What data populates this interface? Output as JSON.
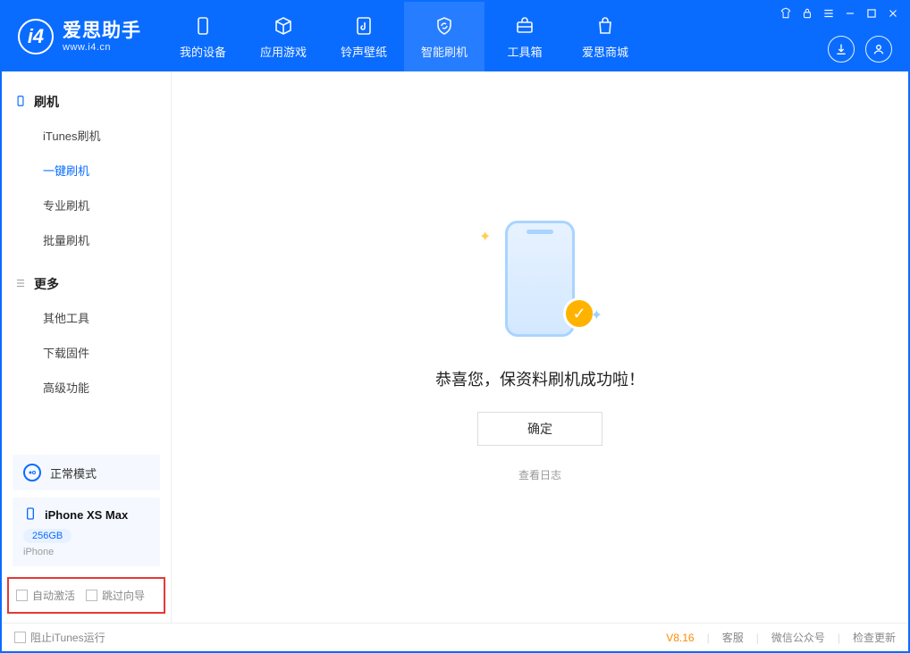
{
  "brand": {
    "title": "爱思助手",
    "sub": "www.i4.cn",
    "logo_letter": "i4"
  },
  "nav": [
    {
      "label": "我的设备"
    },
    {
      "label": "应用游戏"
    },
    {
      "label": "铃声壁纸"
    },
    {
      "label": "智能刷机"
    },
    {
      "label": "工具箱"
    },
    {
      "label": "爱思商城"
    }
  ],
  "sidebar": {
    "section1": {
      "title": "刷机",
      "items": [
        "iTunes刷机",
        "一键刷机",
        "专业刷机",
        "批量刷机"
      ]
    },
    "section2": {
      "title": "更多",
      "items": [
        "其他工具",
        "下载固件",
        "高级功能"
      ]
    },
    "mode": "正常模式",
    "device": {
      "name": "iPhone XS Max",
      "storage": "256GB",
      "type": "iPhone"
    },
    "options": {
      "auto_activate": "自动激活",
      "skip_guide": "跳过向导"
    }
  },
  "content": {
    "message": "恭喜您，保资料刷机成功啦！",
    "ok": "确定",
    "log": "查看日志"
  },
  "footer": {
    "block_itunes": "阻止iTunes运行",
    "version": "V8.16",
    "links": [
      "客服",
      "微信公众号",
      "检查更新"
    ]
  }
}
